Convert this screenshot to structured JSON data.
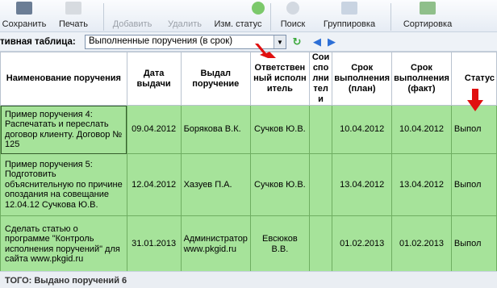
{
  "toolbar": {
    "buttons": [
      {
        "label": "Сохранить",
        "icon": "save-icon"
      },
      {
        "label": "Печать",
        "icon": "print-icon"
      },
      {
        "label": "Добавить",
        "icon": "add-icon",
        "disabled": true
      },
      {
        "label": "Удалить",
        "icon": "delete-icon",
        "disabled": true
      },
      {
        "label": "Изм. статус",
        "icon": "change-status-icon"
      },
      {
        "label": "Поиск",
        "icon": "search-icon"
      },
      {
        "label": "Группировка",
        "icon": "group-icon"
      },
      {
        "label": "Сортировка",
        "icon": "sort-icon"
      }
    ]
  },
  "tablebar": {
    "label": "тивная таблица:",
    "selected": "Выполненные поручения (в срок)"
  },
  "grid": {
    "columns": [
      "Наименование поручения",
      "Дата выдачи",
      "Выдал поручение",
      "Ответственный исполнитель",
      "Соисполнители",
      "Срок выполнения (план)",
      "Срок выполнения (факт)",
      "Статус"
    ],
    "rows": [
      {
        "name": "Пример поручения 4: Распечатать и переслать договор клиенту. Договор № 125",
        "date": "09.04.2012",
        "issuer": "Борякова В.К.",
        "responsible": "Сучков Ю.В.",
        "co": "",
        "plan": "10.04.2012",
        "fact": "10.04.2012",
        "status": "Выпол"
      },
      {
        "name": "Пример поручения 5: Подготовить объяснительную по причине опоздания на совещание 12.04.12 Сучкова Ю.В.",
        "date": "12.04.2012",
        "issuer": "Хазуев П.А.",
        "responsible": "Сучков Ю.В.",
        "co": "",
        "plan": "13.04.2012",
        "fact": "13.04.2012",
        "status": "Выпол"
      },
      {
        "name": "Сделать статью о программе \"Контроль исполнения поручений\" для сайта www.pkgid.ru",
        "date": "31.01.2013",
        "issuer": "Администратор www.pkgid.ru",
        "responsible": "Евсюков В.В.",
        "co": "",
        "plan": "01.02.2013",
        "fact": "01.02.2013",
        "status": "Выпол"
      }
    ]
  },
  "footer": {
    "text": "ТОГО: Выдано поручений 6"
  },
  "colors": {
    "row_green": "#a6e39a",
    "arrow_red": "#e01010",
    "refresh_green": "#3aa83a",
    "nav_blue": "#2d6fd6"
  }
}
